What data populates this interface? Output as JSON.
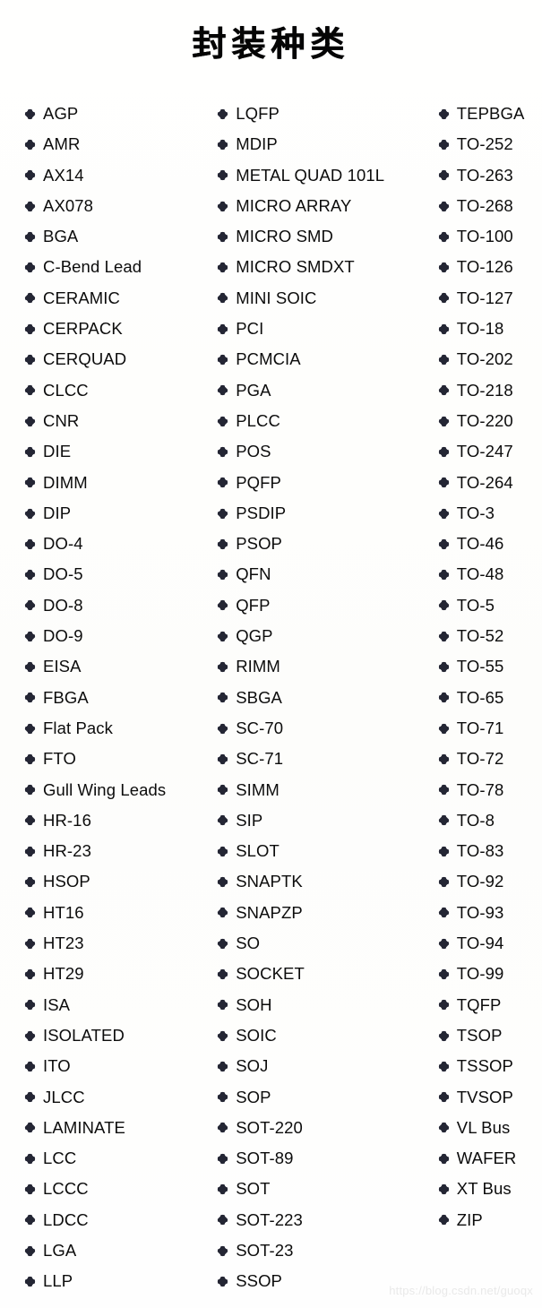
{
  "page": {
    "title": "封装种类",
    "watermark": "https://blog.csdn.net/guoqx",
    "bullet_icon": "diamond-cross-bullet-icon",
    "colors": {
      "background": "#fefefd",
      "text": "#0c0c0c",
      "title": "#050505",
      "bullet": "#242634",
      "watermark": "#e9e9e9"
    }
  },
  "columns": [
    {
      "name": "column-1",
      "items": [
        "AGP",
        "AMR",
        "AX14",
        "AX078",
        "BGA",
        "C-Bend Lead",
        "CERAMIC",
        "CERPACK",
        "CERQUAD",
        "CLCC",
        "CNR",
        "DIE",
        "DIMM",
        "DIP",
        "DO-4",
        "DO-5",
        "DO-8",
        "DO-9",
        "EISA",
        "FBGA",
        "Flat Pack",
        "FTO",
        "Gull Wing Leads",
        "HR-16",
        "HR-23",
        "HSOP",
        "HT16",
        "HT23",
        "HT29",
        "ISA",
        "ISOLATED",
        "ITO",
        "JLCC",
        "LAMINATE",
        "LCC",
        "LCCC",
        "LDCC",
        "LGA",
        "LLP"
      ]
    },
    {
      "name": "column-2",
      "items": [
        "LQFP",
        "MDIP",
        "METAL QUAD 101L",
        "MICRO ARRAY",
        "MICRO SMD",
        "MICRO SMDXT",
        "MINI SOIC",
        "PCI",
        "PCMCIA",
        "PGA",
        "PLCC",
        "POS",
        "PQFP",
        "PSDIP",
        "PSOP",
        "QFN",
        "QFP",
        "QGP",
        "RIMM",
        "SBGA",
        "SC-70",
        "SC-71",
        "SIMM",
        "SIP",
        "SLOT",
        "SNAPTK",
        "SNAPZP",
        "SO",
        "SOCKET",
        "SOH",
        "SOIC",
        "SOJ",
        "SOP",
        "SOT-220",
        "SOT-89",
        "SOT",
        "SOT-223",
        "SOT-23",
        "SSOP"
      ]
    },
    {
      "name": "column-3",
      "items": [
        "TEPBGA",
        "TO-252",
        "TO-263",
        "TO-268",
        "TO-100",
        "TO-126",
        "TO-127",
        "TO-18",
        "TO-202",
        "TO-218",
        "TO-220",
        "TO-247",
        "TO-264",
        "TO-3",
        "TO-46",
        "TO-48",
        "TO-5",
        "TO-52",
        "TO-55",
        "TO-65",
        "TO-71",
        "TO-72",
        "TO-78",
        "TO-8",
        "TO-83",
        "TO-92",
        "TO-93",
        "TO-94",
        "TO-99",
        "TQFP",
        "TSOP",
        "TSSOP",
        "TVSOP",
        "VL Bus",
        "WAFER",
        "XT Bus",
        "ZIP"
      ]
    }
  ]
}
